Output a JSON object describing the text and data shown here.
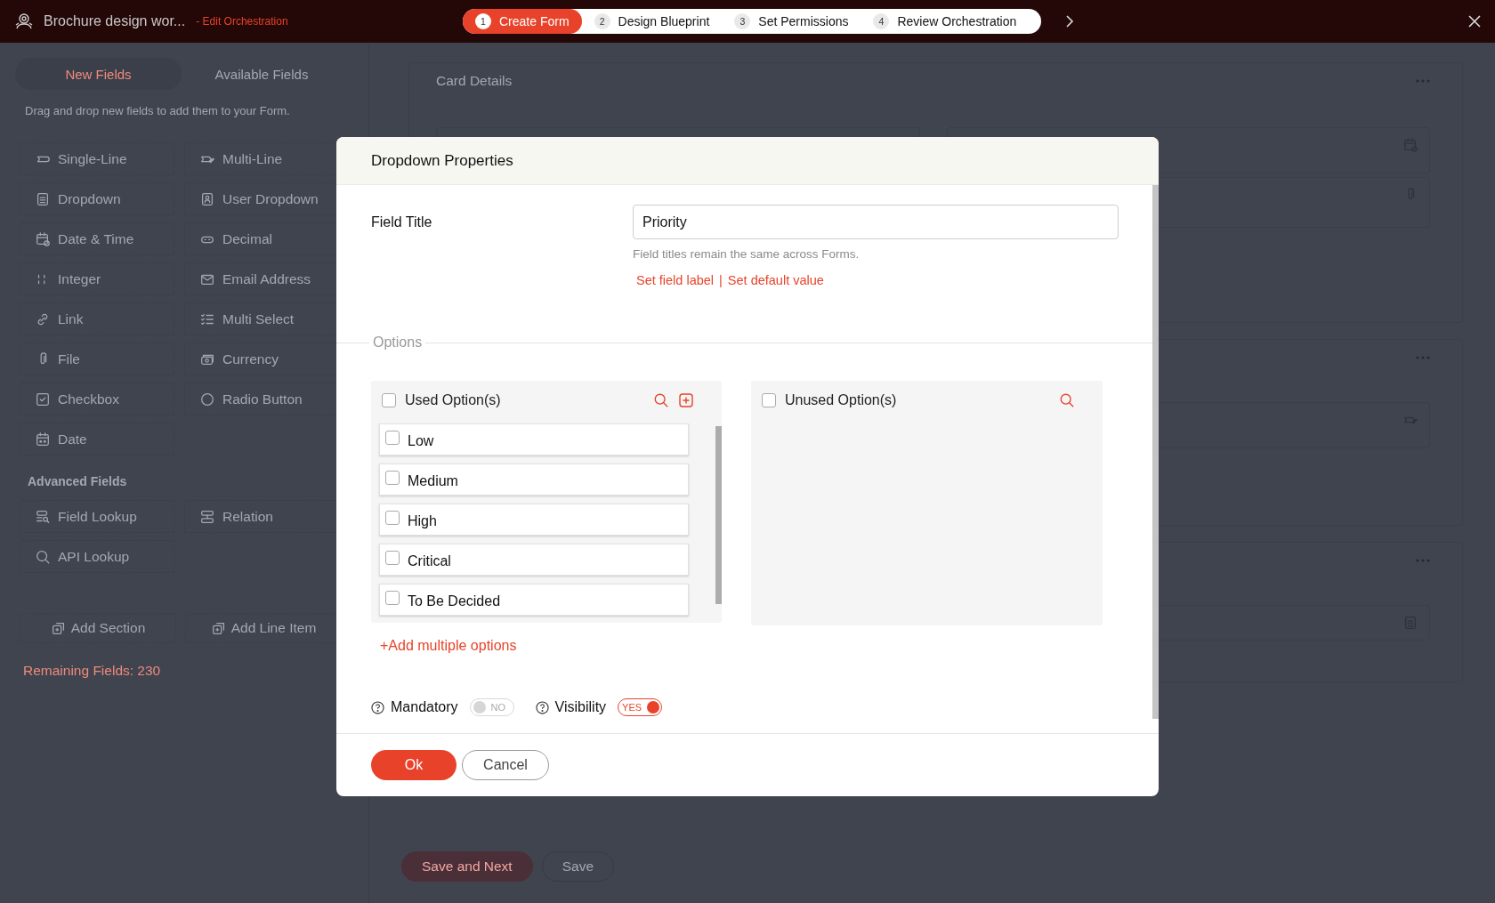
{
  "top_bar": {
    "title": "Brochure design wor...",
    "subtitle": "- Edit Orchestration",
    "steps": [
      {
        "number": "1",
        "label": "Create Form",
        "selected": true
      },
      {
        "number": "2",
        "label": "Design Blueprint",
        "selected": false
      },
      {
        "number": "3",
        "label": "Set Permissions",
        "selected": false
      },
      {
        "number": "4",
        "label": "Review Orchestration",
        "selected": false
      }
    ]
  },
  "sidebar": {
    "tabs": [
      {
        "label": "New Fields",
        "selected": true
      },
      {
        "label": "Available Fields",
        "selected": false
      }
    ],
    "hint": "Drag and drop new fields to add them to your Form.",
    "fields": [
      {
        "label": "Single-Line",
        "kind": "singleline"
      },
      {
        "label": "Multi-Line",
        "kind": "multiline"
      },
      {
        "label": "Dropdown",
        "kind": "dropdown"
      },
      {
        "label": "User Dropdown",
        "kind": "userdropdown"
      },
      {
        "label": "Date & Time",
        "kind": "datetime"
      },
      {
        "label": "Decimal",
        "kind": "decimal"
      },
      {
        "label": "Integer",
        "kind": "integer"
      },
      {
        "label": "Email Address",
        "kind": "email"
      },
      {
        "label": "Link",
        "kind": "link"
      },
      {
        "label": "Multi Select",
        "kind": "multiselect"
      },
      {
        "label": "File",
        "kind": "file"
      },
      {
        "label": "Currency",
        "kind": "currency"
      },
      {
        "label": "Checkbox",
        "kind": "checkbox"
      },
      {
        "label": "Radio Button",
        "kind": "radio"
      },
      {
        "label": "Date",
        "kind": "date"
      }
    ],
    "advanced_heading": "Advanced Fields",
    "advanced_fields": [
      {
        "label": "Field Lookup",
        "kind": "lookup"
      },
      {
        "label": "Relation",
        "kind": "relation"
      },
      {
        "label": "API Lookup",
        "kind": "api"
      }
    ],
    "actions": [
      {
        "label": "Add Section"
      },
      {
        "label": "Add Line Item"
      }
    ],
    "remaining": "Remaining Fields: 230"
  },
  "main": {
    "sections": [
      {
        "title": "Card Details",
        "fields": [
          {
            "kind": "text"
          },
          {
            "kind": "datetime"
          },
          {
            "kind": "file"
          }
        ]
      },
      {
        "fields": [
          {
            "kind": "multiline"
          }
        ]
      },
      {
        "fields": [
          {
            "kind": "dropdown"
          }
        ]
      }
    ],
    "buttons": [
      {
        "label": "Save and Next",
        "kind": "primary"
      },
      {
        "label": "Save",
        "kind": "secondary"
      }
    ]
  },
  "dialog": {
    "title": "Dropdown Properties",
    "field_title": {
      "label": "Field Title",
      "value": "Priority",
      "hint": "Field titles remain the same across Forms.",
      "links": [
        "Set field label",
        "Set default value"
      ],
      "separator": "|"
    },
    "options": {
      "legend": "Options",
      "used": {
        "label": "Used Option(s)",
        "checked": false,
        "items": [
          {
            "label": "Low",
            "checked": false
          },
          {
            "label": "Medium",
            "checked": false
          },
          {
            "label": "High",
            "checked": false
          },
          {
            "label": "Critical",
            "checked": false
          },
          {
            "label": "To Be Decided",
            "checked": false
          }
        ]
      },
      "unused": {
        "label": "Unused Option(s)",
        "checked": false
      },
      "add_link": "+Add multiple options"
    },
    "toggles": [
      {
        "label": "Mandatory",
        "on": false,
        "state": "NO"
      },
      {
        "label": "Visibility",
        "on": true,
        "state": "YES"
      }
    ],
    "buttons": [
      {
        "label": "Ok",
        "kind": "primary"
      },
      {
        "label": "Cancel",
        "kind": "secondary"
      }
    ]
  }
}
